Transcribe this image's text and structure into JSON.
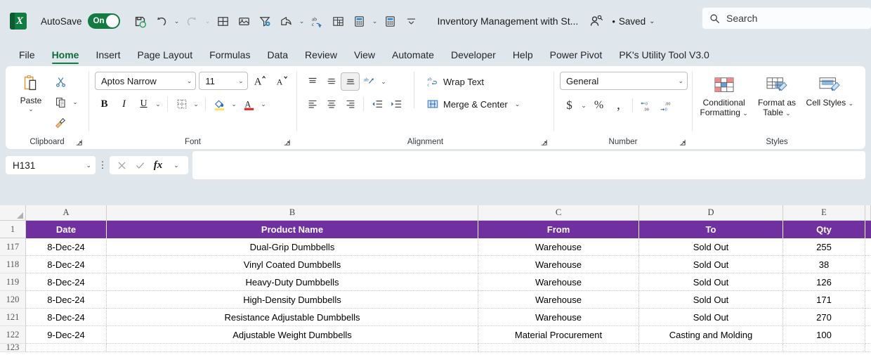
{
  "titlebar": {
    "app_icon": "excel-logo",
    "autosave_label": "AutoSave",
    "autosave_state": "On",
    "document_title": "Inventory Management with St...",
    "save_status": "Saved",
    "save_status_dot": "•",
    "quick_access": [
      {
        "name": "save-icon",
        "label": "Save"
      },
      {
        "name": "undo-icon",
        "label": "Undo"
      },
      {
        "name": "redo-icon",
        "label": "Redo"
      },
      {
        "name": "table-icon",
        "label": "Table"
      },
      {
        "name": "picture-icon",
        "label": "Picture"
      },
      {
        "name": "filter-settings-icon",
        "label": "Filter"
      },
      {
        "name": "share-icon",
        "label": "Share"
      },
      {
        "name": "spelling-icon",
        "label": "Spelling"
      },
      {
        "name": "freeze-panes-icon",
        "label": "Freeze Panes"
      },
      {
        "name": "calculator-icon",
        "label": "Calculate Now"
      },
      {
        "name": "calculator-sheet-icon",
        "label": "Calculate Sheet"
      },
      {
        "name": "customize-quick-access-icon",
        "label": "Customize Quick Access Toolbar"
      }
    ]
  },
  "search": {
    "placeholder": "Search",
    "icon": "search-icon"
  },
  "tabs": [
    {
      "label": "File",
      "active": false
    },
    {
      "label": "Home",
      "active": true
    },
    {
      "label": "Insert",
      "active": false
    },
    {
      "label": "Page Layout",
      "active": false
    },
    {
      "label": "Formulas",
      "active": false
    },
    {
      "label": "Data",
      "active": false
    },
    {
      "label": "Review",
      "active": false
    },
    {
      "label": "View",
      "active": false
    },
    {
      "label": "Automate",
      "active": false
    },
    {
      "label": "Developer",
      "active": false
    },
    {
      "label": "Help",
      "active": false
    },
    {
      "label": "Power Pivot",
      "active": false
    },
    {
      "label": "PK's Utility Tool V3.0",
      "active": false
    }
  ],
  "ribbon": {
    "clipboard": {
      "group_label": "Clipboard",
      "paste_label": "Paste",
      "cut_label": "Cut",
      "copy_label": "Copy",
      "format_painter_label": "Format Painter"
    },
    "font": {
      "group_label": "Font",
      "font_name": "Aptos Narrow",
      "font_size": "11",
      "grow_font_label": "A",
      "shrink_font_label": "A",
      "bold_label": "B",
      "italic_label": "I",
      "underline_label": "U",
      "borders_label": "Borders",
      "fill_color_label": "Fill Color",
      "font_color_label": "A"
    },
    "alignment": {
      "group_label": "Alignment",
      "wrap_text_label": "Wrap Text",
      "merge_center_label": "Merge & Center",
      "orientation_label": "Orientation",
      "align_top_label": "Top Align",
      "align_middle_label": "Middle Align",
      "align_bottom_label": "Bottom Align",
      "align_left_label": "Align Left",
      "align_center_label": "Center",
      "align_right_label": "Align Right",
      "decrease_indent_label": "Decrease Indent",
      "increase_indent_label": "Increase Indent"
    },
    "number": {
      "group_label": "Number",
      "format": "General",
      "accounting_label": "$",
      "percent_label": "%",
      "comma_label": ",",
      "increase_decimal_label": "Increase Decimal",
      "decrease_decimal_label": "Decrease Decimal"
    },
    "styles": {
      "group_label": "Styles",
      "conditional_formatting_label": "Conditional Formatting",
      "format_as_table_label": "Format as Table",
      "cell_styles_label": "Cell Styles"
    }
  },
  "formula_bar": {
    "name_box": "H131",
    "cancel_label": "Cancel",
    "enter_label": "Enter",
    "fx_label": "fx",
    "value": ""
  },
  "grid": {
    "columns": [
      {
        "letter": "A",
        "width_class": "w-a"
      },
      {
        "letter": "B",
        "width_class": "w-b"
      },
      {
        "letter": "C",
        "width_class": "w-c"
      },
      {
        "letter": "D",
        "width_class": "w-d"
      },
      {
        "letter": "E",
        "width_class": "w-e"
      }
    ],
    "header_row_number": "1",
    "headers": [
      "Date",
      "Product Name",
      "From",
      "To",
      "Qty"
    ],
    "rows": [
      {
        "n": "117",
        "cells": [
          "8-Dec-24",
          "Dual-Grip Dumbbells",
          "Warehouse",
          "Sold Out",
          "255"
        ]
      },
      {
        "n": "118",
        "cells": [
          "8-Dec-24",
          "Vinyl Coated Dumbbells",
          "Warehouse",
          "Sold Out",
          "38"
        ]
      },
      {
        "n": "119",
        "cells": [
          "8-Dec-24",
          "Heavy-Duty Dumbbells",
          "Warehouse",
          "Sold Out",
          "126"
        ]
      },
      {
        "n": "120",
        "cells": [
          "8-Dec-24",
          "High-Density Dumbbells",
          "Warehouse",
          "Sold Out",
          "171"
        ]
      },
      {
        "n": "121",
        "cells": [
          "8-Dec-24",
          "Resistance Adjustable Dumbbells",
          "Warehouse",
          "Sold Out",
          "270"
        ]
      },
      {
        "n": "122",
        "cells": [
          "9-Dec-24",
          "Adjustable Weight Dumbbells",
          "Material Procurement",
          "Casting and Molding",
          "100"
        ]
      },
      {
        "n": "123",
        "cells": [
          "",
          "",
          "",
          "",
          ""
        ]
      }
    ]
  },
  "colors": {
    "header_purple": "#7030A0",
    "excel_green": "#107C41",
    "window_bg": "#DFE7EC"
  }
}
